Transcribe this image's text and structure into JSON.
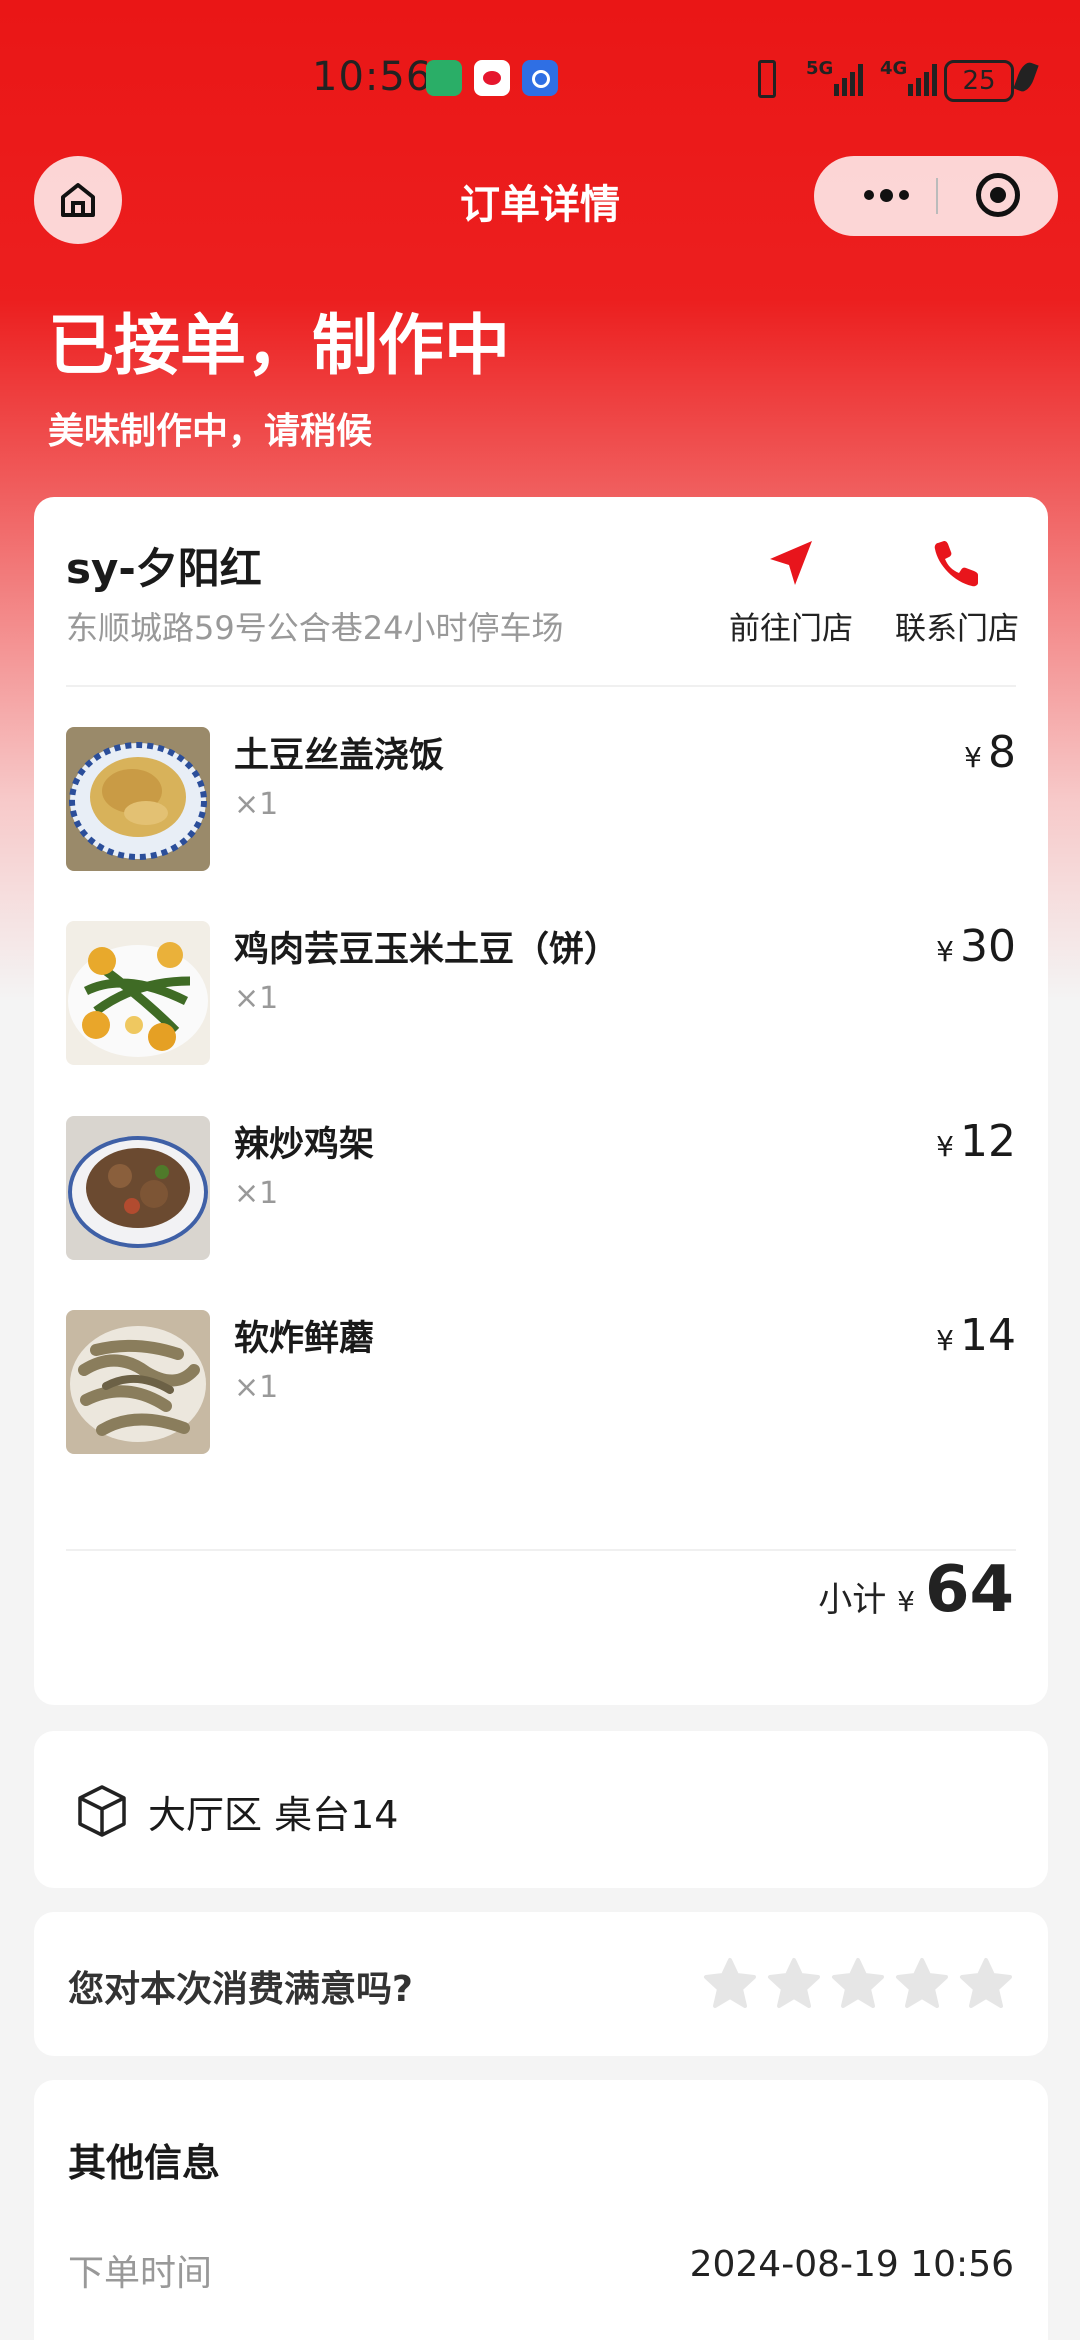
{
  "status_bar": {
    "time": "10:56",
    "signal_1": "5G",
    "signal_2": "4G",
    "battery": "25"
  },
  "nav": {
    "title": "订单详情",
    "home_icon": "home-icon",
    "more_icon": "more-dots-icon",
    "close_icon": "target-icon"
  },
  "header": {
    "status": "已接单，制作中",
    "sub": "美味制作中，请稍候"
  },
  "store": {
    "name": "sy-夕阳红",
    "address": "东顺城路59号公合巷24小时停车场",
    "navigate_label": "前往门店",
    "call_label": "联系门店"
  },
  "items": [
    {
      "name": "土豆丝盖浇饭",
      "qty": "×1",
      "currency": "¥",
      "price": "8"
    },
    {
      "name": "鸡肉芸豆玉米土豆（饼）",
      "qty": "×1",
      "currency": "¥",
      "price": "30"
    },
    {
      "name": "辣炒鸡架",
      "qty": "×1",
      "currency": "¥",
      "price": "12"
    },
    {
      "name": "软炸鲜蘑",
      "qty": "×1",
      "currency": "¥",
      "price": "14"
    }
  ],
  "subtotal": {
    "label": "小计",
    "currency": "¥",
    "value": "64"
  },
  "table": {
    "text": "大厅区 桌台14"
  },
  "rating": {
    "question": "您对本次消费满意吗?",
    "stars_total": 5,
    "stars_selected": 0
  },
  "other": {
    "title": "其他信息",
    "rows": [
      {
        "label": "下单时间",
        "value": "2024-08-19 10:56"
      }
    ]
  },
  "colors": {
    "brand_red": "#ea1616",
    "nav_red": "#e8151c"
  }
}
